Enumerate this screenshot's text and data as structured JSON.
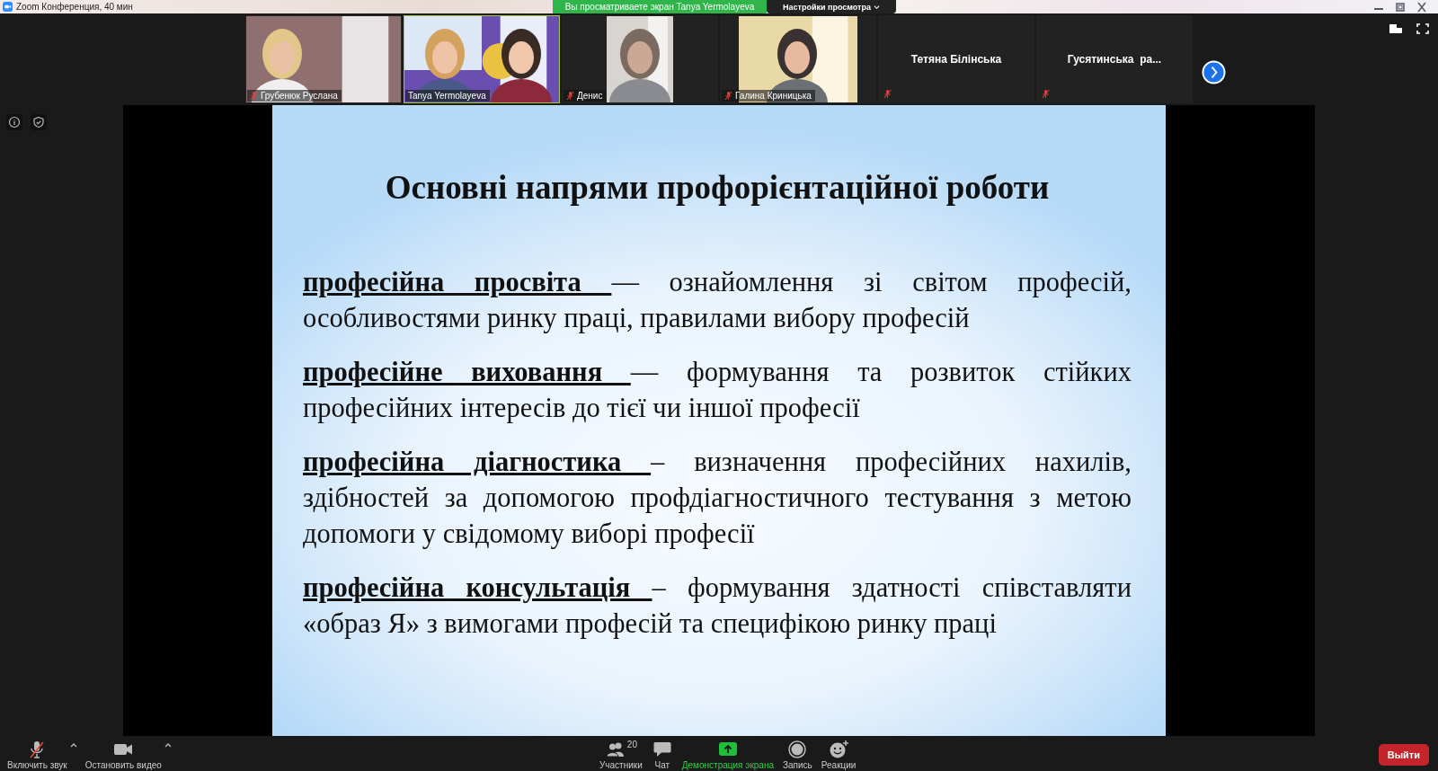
{
  "window": {
    "title": "Zoom Конференция, 40 мин"
  },
  "share_banner": {
    "text": "Вы просматриваете экран Tanya Yermolayeva"
  },
  "view_options": {
    "label": "Настройки просмотра"
  },
  "participants": [
    {
      "name": "Грубенюк Руслана",
      "kind": "video",
      "muted": true,
      "active_speaker": false
    },
    {
      "name": "Tanya Yermolayeva",
      "kind": "video",
      "muted": false,
      "active_speaker": true
    },
    {
      "name": "Денис",
      "kind": "video",
      "muted": true,
      "active_speaker": false
    },
    {
      "name": "Галина Криницька",
      "kind": "video",
      "muted": true,
      "active_speaker": false
    },
    {
      "name": "Тетяна Білінська",
      "kind": "name",
      "muted": true,
      "active_speaker": false
    },
    {
      "name": "Гусятинська  ра...",
      "kind": "name",
      "muted": true,
      "active_speaker": false
    }
  ],
  "slide": {
    "title": "Основні напрями профорієнтаційної роботи",
    "items": [
      {
        "term": "професійна просвіта ",
        "definition": "— ознайомлення зі світом професій, особливостями ринку праці, правилами вибору професій"
      },
      {
        "term": "професійне виховання ",
        "definition": "— формування та розвиток стійких професійних інтересів до тієї чи іншої професії"
      },
      {
        "term": "професійна діагностика ",
        "definition": "– визначення професійних нахилів, здібностей за допомогою профдіагностичного тестування з метою допомоги у свідомому виборі професії"
      },
      {
        "term": "професійна консультація ",
        "definition": "– формування здатності співставляти «образ Я» з вимогами професій та специфікою ринку праці"
      }
    ]
  },
  "toolbar": {
    "left": [
      {
        "kind": "audio",
        "label": "Включить звук",
        "muted": true
      },
      {
        "kind": "video",
        "label": "Остановить видео"
      }
    ],
    "center": [
      {
        "kind": "participants",
        "label": "Участники",
        "count": "20"
      },
      {
        "kind": "chat",
        "label": "Чат"
      },
      {
        "kind": "share",
        "label": "Демонстрация экрана",
        "highlighted": true
      },
      {
        "kind": "record",
        "label": "Запись"
      },
      {
        "kind": "reactions",
        "label": "Реакции"
      }
    ],
    "leave_button": "Выйти"
  }
}
